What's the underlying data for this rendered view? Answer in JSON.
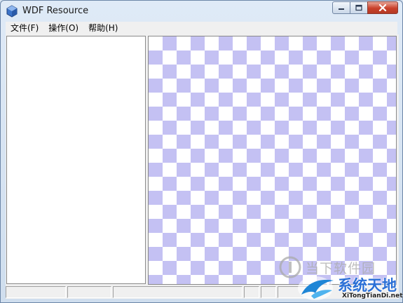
{
  "window": {
    "title": "WDF Resource",
    "app_icon": "cube-icon",
    "caption_buttons": [
      "minimize-icon",
      "maximize-icon",
      "close-icon"
    ]
  },
  "menubar": {
    "items": [
      {
        "label": "文件(F)"
      },
      {
        "label": "操作(O)"
      },
      {
        "label": "帮助(H)"
      }
    ]
  },
  "panes": {
    "preview_background": {
      "checker_color": "#c4c1f3",
      "base_color": "#ffffff"
    }
  },
  "watermark": {
    "site_text": "当下软件园",
    "logo_title": "系统天地",
    "logo_subtitle": "XiTongTianDi.net"
  }
}
